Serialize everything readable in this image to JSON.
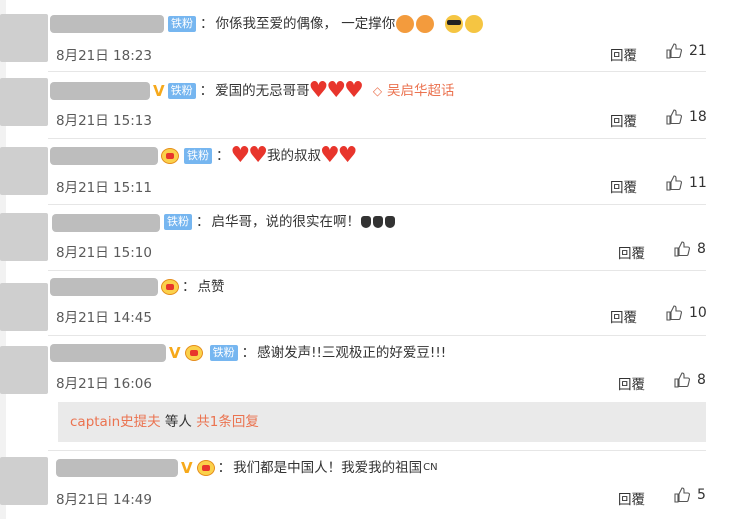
{
  "comments": [
    {
      "tag": "铁粉",
      "text": "你係我至爱的偶像， 一定撑你",
      "time": "8月21日 18:23",
      "reply": "回覆",
      "likes": "21"
    },
    {
      "tag": "铁粉",
      "text": "爱国的无忌哥哥",
      "super_topic": "吴启华超话",
      "time": "8月21日 15:13",
      "reply": "回覆",
      "likes": "18"
    },
    {
      "tag": "铁粉",
      "text_before": "",
      "text_mid": "我的叔叔",
      "time": "8月21日 15:11",
      "reply": "回覆",
      "likes": "11"
    },
    {
      "tag": "铁粉",
      "text": "启华哥，说的很实在啊！",
      "time": "8月21日 15:10",
      "reply": "回覆",
      "likes": "8"
    },
    {
      "text": "点赞",
      "time": "8月21日 14:45",
      "reply": "回覆",
      "likes": "10"
    },
    {
      "tag": "铁粉",
      "text": "感谢发声!!三观极正的好爱豆!!!",
      "time": "8月21日 16:06",
      "reply": "回覆",
      "likes": "8",
      "sub": {
        "user": "captain史提夫",
        "middle": " 等人 ",
        "link": "共1条回复"
      }
    },
    {
      "text": "我们都是中国人！我爱我的祖国",
      "cn": "CN",
      "time": "8月21日 14:49",
      "reply": "回覆",
      "likes": "5"
    }
  ],
  "colon": "：",
  "colors": {
    "tag_bg": "#76b6f0",
    "heart": "#e8352c",
    "link": "#eb7350",
    "vip": "#f6a91b"
  },
  "icons": [
    "thumb-up-icon",
    "heart-icon",
    "diamond-icon",
    "crown-badge-icon",
    "vip-v-icon"
  ]
}
